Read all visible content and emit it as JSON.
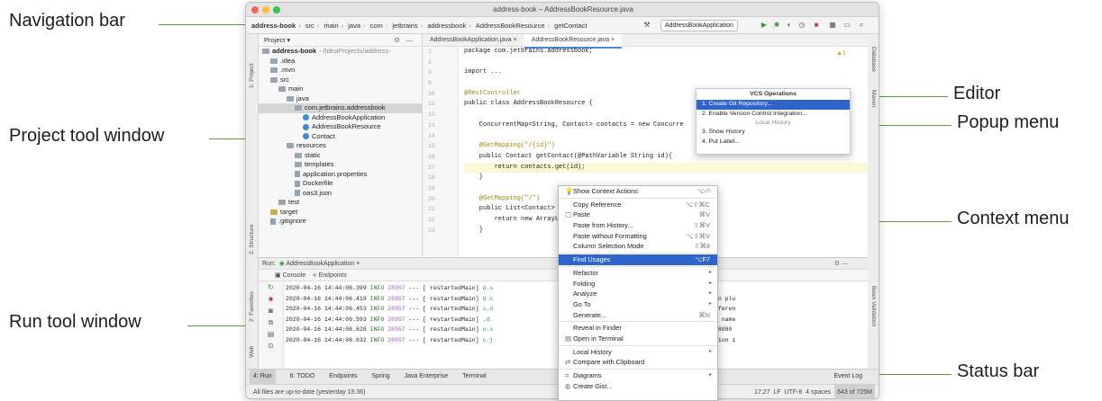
{
  "callouts": {
    "navigation_bar": "Navigation bar",
    "project_tool_window": "Project tool window",
    "run_tool_window": "Run tool window",
    "editor": "Editor",
    "popup_menu": "Popup menu",
    "context_menu": "Context menu",
    "status_bar": "Status bar"
  },
  "window": {
    "title": "address-book – AddressBookResource.java"
  },
  "navbar": {
    "crumbs": [
      "address-book",
      "src",
      "main",
      "java",
      "com",
      "jetbrains",
      "addressbook",
      "AddressBookResource",
      "getContact"
    ],
    "run_config": "AddressBookApplication"
  },
  "project": {
    "header": "Project",
    "tree": [
      {
        "label": "address-book",
        "extra": "~/IdeaProjects/address-",
        "depth": 0,
        "kind": "folder"
      },
      {
        "label": ".idea",
        "depth": 1,
        "kind": "folder"
      },
      {
        "label": ".mvn",
        "depth": 1,
        "kind": "folder"
      },
      {
        "label": "src",
        "depth": 1,
        "kind": "folder"
      },
      {
        "label": "main",
        "depth": 2,
        "kind": "folder"
      },
      {
        "label": "java",
        "depth": 3,
        "kind": "folder"
      },
      {
        "label": "com.jetbrains.addressbook",
        "depth": 4,
        "kind": "folder",
        "selected": true
      },
      {
        "label": "AddressBookApplication",
        "depth": 5,
        "kind": "class"
      },
      {
        "label": "AddressBookResource",
        "depth": 5,
        "kind": "class"
      },
      {
        "label": "Contact",
        "depth": 5,
        "kind": "class"
      },
      {
        "label": "resources",
        "depth": 3,
        "kind": "folder"
      },
      {
        "label": "static",
        "depth": 4,
        "kind": "folder"
      },
      {
        "label": "templates",
        "depth": 4,
        "kind": "folder"
      },
      {
        "label": "application.properties",
        "depth": 4,
        "kind": "file"
      },
      {
        "label": "Dockerfile",
        "depth": 4,
        "kind": "file"
      },
      {
        "label": "oas3.json",
        "depth": 4,
        "kind": "file"
      },
      {
        "label": "test",
        "depth": 2,
        "kind": "folder"
      },
      {
        "label": "target",
        "depth": 1,
        "kind": "folder-orange"
      },
      {
        "label": ".gitignore",
        "depth": 1,
        "kind": "file"
      }
    ]
  },
  "editor": {
    "tabs": [
      "AddressBookApplication.java",
      "AddressBookResource.java"
    ],
    "line_numbers": [
      "1",
      "2",
      "3",
      "9",
      "10",
      "11",
      "12",
      "13",
      "14",
      "15",
      "16",
      "17",
      "18",
      "19",
      "20",
      "21",
      "22",
      "23"
    ],
    "lines": [
      "package com.jetbrains.addressbook;",
      "",
      "import ...",
      "",
      "@RestController",
      "public class AddressBookResource {",
      "",
      "    ConcurrentMap<String, Contact> contacts = new Concurre",
      "",
      "    @GetMapping(\"/{id}\")",
      "    public Contact getContact(@PathVariable String id){",
      "        return contacts.get(id);",
      "    }",
      "",
      "    @GetMapping(\"/\")",
      "    public List<Contact> g",
      "        return new ArrayLi",
      "    }"
    ],
    "warning": "▲1"
  },
  "popup": {
    "title": "VCS Operations",
    "items": [
      "1. Create Git Repository...",
      "2. Enable Version Control Integration..."
    ],
    "section": "Local History",
    "items2": [
      "3. Show History",
      "4. Put Label..."
    ]
  },
  "context_menu": {
    "items": [
      {
        "label": "Show Context Actions",
        "shortcut": "⌥⏎",
        "icon": "bulb-icon"
      },
      {
        "label": "Copy Reference",
        "shortcut": "⌥⇧⌘C"
      },
      {
        "label": "Paste",
        "shortcut": "⌘V",
        "icon": "paste-icon"
      },
      {
        "label": "Paste from History...",
        "shortcut": "⇧⌘V"
      },
      {
        "label": "Paste without Formatting",
        "shortcut": "⌥⇧⌘V"
      },
      {
        "label": "Column Selection Mode",
        "shortcut": "⇧⌘8"
      },
      {
        "label": "Find Usages",
        "shortcut": "⌥F7",
        "selected": true
      },
      {
        "label": "Refactor",
        "submenu": true
      },
      {
        "label": "Folding",
        "submenu": true
      },
      {
        "label": "Analyze",
        "submenu": true
      },
      {
        "label": "Go To",
        "submenu": true
      },
      {
        "label": "Generate...",
        "shortcut": "⌘N"
      },
      {
        "label": "Reveal in Finder"
      },
      {
        "label": "Open in Terminal",
        "icon": "terminal-icon"
      },
      {
        "label": "Local History",
        "submenu": true
      },
      {
        "label": "Compare with Clipboard",
        "icon": "compare-icon"
      },
      {
        "label": "Diagrams",
        "submenu": true,
        "icon": "diagram-icon"
      },
      {
        "label": "Create Gist...",
        "icon": "github-icon"
      }
    ]
  },
  "run": {
    "label": "Run:",
    "config": "AddressBookApplication",
    "tabs": [
      "Console",
      "Endpoints"
    ],
    "logs": [
      {
        "time": "2020-04-16 14:44:06.399",
        "level": "INFO",
        "pid": "28957",
        "thread": "restartedMain",
        "src": "d.s",
        "msg": ": Context refreshed"
      },
      {
        "time": "2020-04-16 14:44:06.419",
        "level": "INFO",
        "pid": "28957",
        "thread": "restartedMain",
        "src": "d.s",
        "msg": ": Found 1 custom documentation plu"
      },
      {
        "time": "2020-04-16 14:44:06.453",
        "level": "INFO",
        "pid": "28957",
        "thread": "restartedMain",
        "src": "s.d",
        "msg": ": Scanning for api listing referen"
      },
      {
        "time": "2020-04-16 14:44:06.593",
        "level": "INFO",
        "pid": "28957",
        "thread": "restartedMain",
        "src": ".d.",
        "msg": ": Generating unique operation name"
      },
      {
        "time": "2020-04-16 14:44:06.628",
        "level": "INFO",
        "pid": "28957",
        "thread": "restartedMain",
        "src": "o.s",
        "msg": ": Tomcat started on port(s): 8080"
      },
      {
        "time": "2020-04-16 14:44:06.632",
        "level": "INFO",
        "pid": "28957",
        "thread": "restartedMain",
        "src": "c.j",
        "msg": ": Started AddressBookApplication i"
      }
    ]
  },
  "bottom_tabs": [
    "4: Run",
    "6: TODO",
    "Endpoints",
    "Spring",
    "Java Enterprise",
    "Terminal"
  ],
  "event_log": "Event Log",
  "statusbar": {
    "message": "All files are up-to-date (yesterday 15:36)",
    "position": "17:27",
    "line_sep": "LF",
    "encoding": "UTF-8",
    "indent": "4 spaces",
    "memory": "643 of 725M"
  },
  "side_tabs": {
    "left": [
      "1: Project",
      "2: Structure",
      "2: Favorites",
      "Web"
    ],
    "right": [
      "Database",
      "Maven",
      "Bean Validation"
    ]
  },
  "colors": {
    "accent": "#5b9b3a",
    "selection": "#2f65ca"
  }
}
